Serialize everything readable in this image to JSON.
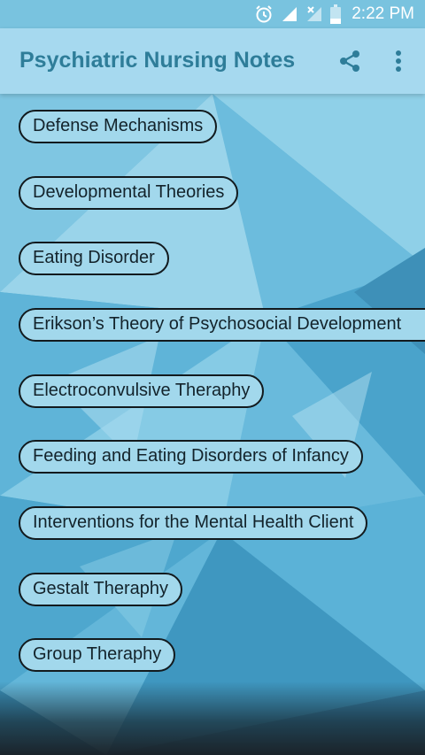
{
  "status_bar": {
    "time": "2:22 PM",
    "icons": [
      "alarm-icon",
      "signal-icon",
      "no-signal-icon",
      "battery-icon"
    ]
  },
  "app_bar": {
    "title": "Psychiatric Nursing Notes",
    "actions": [
      "share-icon",
      "more-vert-icon"
    ]
  },
  "topics": [
    "Defense Mechanisms",
    "Developmental Theories",
    "Eating Disorder",
    "Erikson’s Theory of Psychosocial Development",
    "Electroconvulsive Theraphy",
    "Feeding and Eating Disorders of Infancy",
    "Interventions for the Mental Health Client",
    "Gestalt Theraphy",
    "Group Theraphy"
  ],
  "colors": {
    "status_bar": "#79c3df",
    "app_bar": "#a6d9ef",
    "title_text": "#2e7d99",
    "pill_fill": "#a2d8ec",
    "pill_border": "#121a1e"
  }
}
